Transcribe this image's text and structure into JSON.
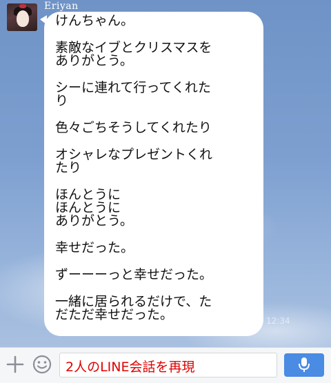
{
  "chat": {
    "sender_name": "Eriyan",
    "message_lines": [
      "けんちゃん。",
      "",
      "素敵なイブとクリスマスを",
      "ありがとう。",
      "",
      "シーに連れて行ってくれた",
      "り",
      "",
      "色々ごちそうしてくれたり",
      "",
      "オシャレなプレゼントくれ",
      "たり",
      "",
      "ほんとうに",
      "ほんとうに",
      "ありがとう。",
      "",
      "幸せだった。",
      "",
      "ずーーーっと幸せだった。",
      "",
      "一緒に居られるだけで、た",
      "だただ幸せだった。"
    ],
    "timestamp": "12:34",
    "bubble_color": "#ffffff",
    "background_color": "#7d9fd0"
  },
  "input_bar": {
    "plus_icon": "plus-icon",
    "emoji_icon": "smiley-icon",
    "input_value": "2人のLINE会話を再現",
    "mic_icon": "microphone-icon",
    "mic_color": "#4a8be3",
    "input_text_color": "#e00000"
  }
}
